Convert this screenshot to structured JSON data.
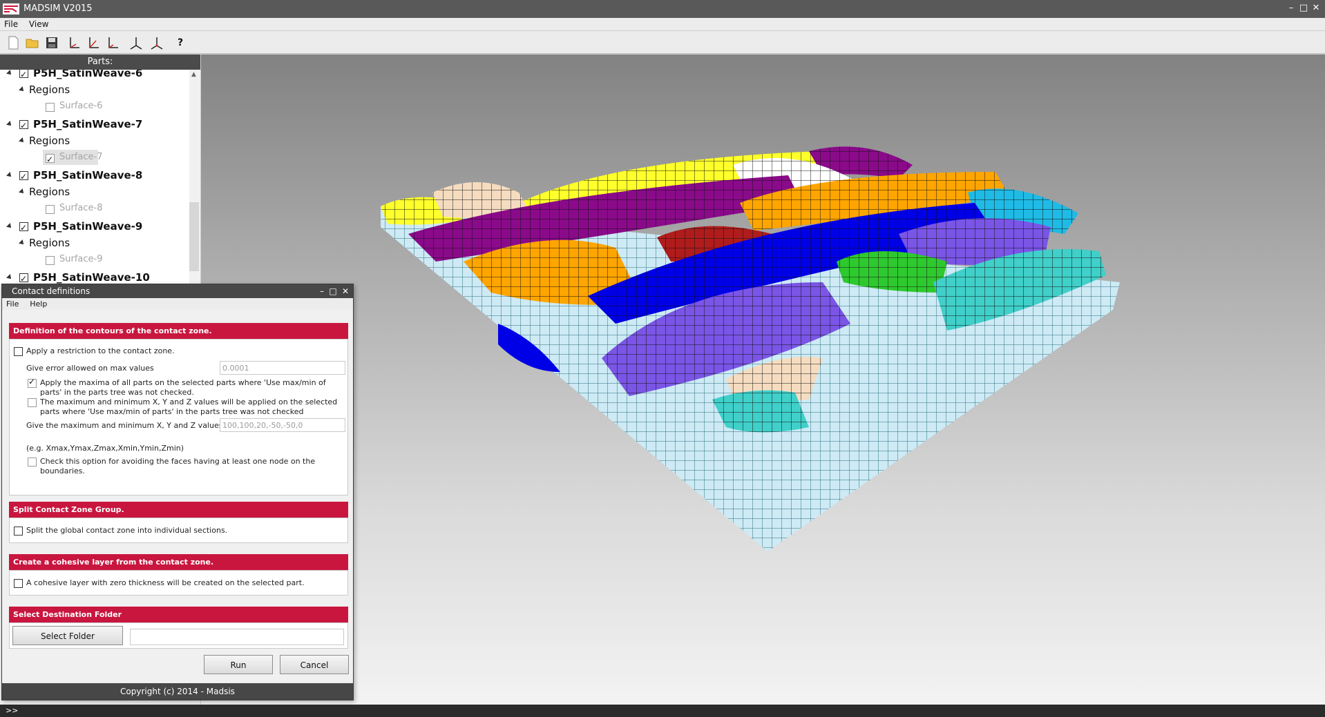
{
  "app": {
    "title": "MADSIM V2015",
    "window_controls": {
      "minimize": "–",
      "maximize": "□",
      "close": "✕"
    }
  },
  "menubar": {
    "file": "File",
    "view": "View"
  },
  "toolbar": {
    "items": [
      "new-file-icon",
      "open-folder-icon",
      "save-icon",
      "axis-x-icon",
      "axis-y-icon",
      "axis-z-icon",
      "axis-xy-icon",
      "axis-xyz-icon",
      "help-icon"
    ],
    "help_label": "?"
  },
  "parts_panel": {
    "header": "Parts:",
    "tree": [
      {
        "part": "P5H_SatinWeave-6",
        "checked": true,
        "regions": "Regions",
        "surface": "Surface-6",
        "surface_checked": false
      },
      {
        "part": "P5H_SatinWeave-7",
        "checked": true,
        "regions": "Regions",
        "surface": "Surface-7",
        "surface_checked": true
      },
      {
        "part": "P5H_SatinWeave-8",
        "checked": true,
        "regions": "Regions",
        "surface": "Surface-8",
        "surface_checked": false
      },
      {
        "part": "P5H_SatinWeave-9",
        "checked": true,
        "regions": "Regions",
        "surface": "Surface-9",
        "surface_checked": false
      },
      {
        "part": "P5H_SatinWeave-10",
        "checked": true
      }
    ]
  },
  "dialog": {
    "title": "Contact definitions",
    "menu": {
      "file": "File",
      "help": "Help"
    },
    "sec1": {
      "header": "Definition of the contours of the contact zone.",
      "restriction": "Apply a restriction to the contact zone.",
      "error_label": "Give error allowed on max values",
      "error_value": "0.0001",
      "apply_maxima": "Apply the maxima of all parts on the selected parts where 'Use max/min of parts' in the parts tree was not checked.",
      "max_min_note": "The maximum and minimum X, Y and Z values will be applied on the selected parts where 'Use max/min of parts' in the parts tree was not checked",
      "maxmin_label": "Give the maximum and minimum X, Y and Z values",
      "maxmin_value": "100,100,20,-50,-50,0",
      "example": "(e.g. Xmax,Ymax,Zmax,Xmin,Ymin,Zmin)",
      "avoid_faces": "Check this option for avoiding the faces having at least one node on the boundaries."
    },
    "sec2": {
      "header": "Split Contact Zone Group.",
      "split": "Split the global contact zone into individual sections."
    },
    "sec3": {
      "header": "Create a cohesive layer from the contact zone.",
      "cohesive": "A cohesive layer with zero thickness will be created on the selected part."
    },
    "sec4": {
      "header": "Select Destination Folder",
      "select_folder": "Select Folder",
      "folder_path": ""
    },
    "run": "Run",
    "cancel": "Cancel",
    "copyright": "Copyright (c) 2014 - Madsis"
  },
  "statusbar": {
    "prompt": ">>"
  },
  "colors": {
    "accent_red": "#c8163f",
    "dark_bar": "#474747",
    "yarns": [
      "#ffff2b",
      "#f5dcc0",
      "#8a0a8a",
      "#ffffff",
      "#ffa500",
      "#b01c1c",
      "#0000e6",
      "#1fbbe6",
      "#7a55e6",
      "#2ec92e",
      "#40cfc9",
      "#cdeaf5"
    ]
  }
}
